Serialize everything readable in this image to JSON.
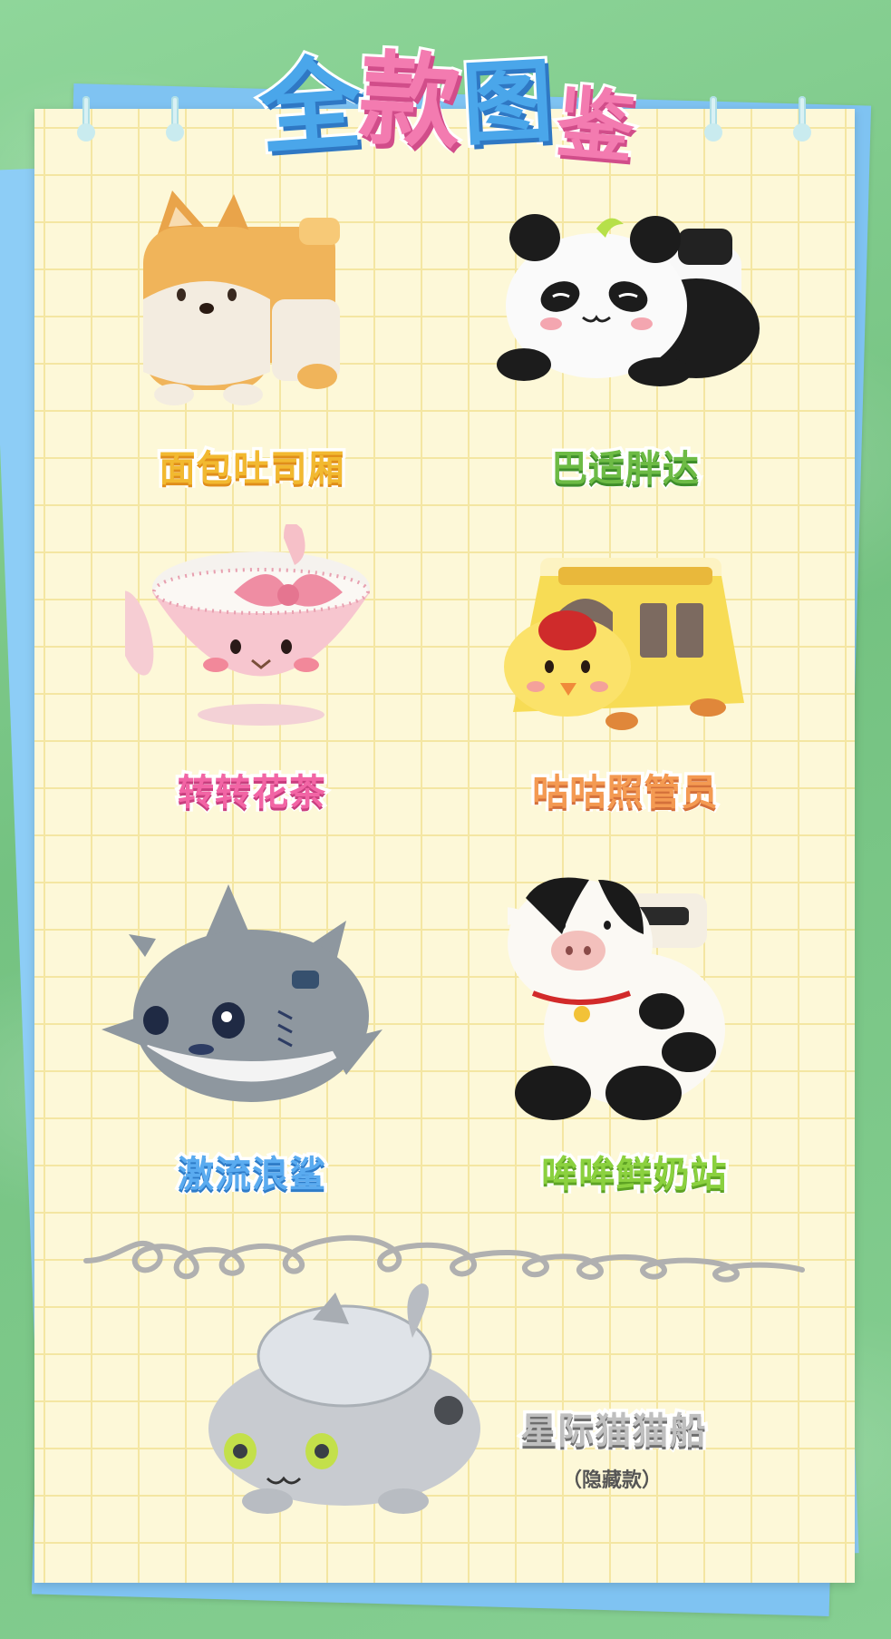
{
  "title": {
    "chars": [
      "全",
      "款",
      "图",
      "鉴"
    ]
  },
  "items": [
    {
      "name": "面包吐司厢",
      "color": "#f2b930",
      "shadow": "#e08e1a",
      "icon": "corgi-plush-icon"
    },
    {
      "name": "巴适胖达",
      "color": "#6dbb45",
      "shadow": "#3f8e2a",
      "icon": "panda-plush-icon"
    },
    {
      "name": "转转花茶",
      "color": "#f265a5",
      "shadow": "#c93f7f",
      "icon": "bunny-teacup-plush-icon"
    },
    {
      "name": "咕咕照管员",
      "color": "#f49a52",
      "shadow": "#d4703a",
      "icon": "chick-schoolbus-plush-icon"
    },
    {
      "name": "激流浪鲨",
      "color": "#5aabf0",
      "shadow": "#2f7cc8",
      "icon": "shark-plush-icon"
    },
    {
      "name": "哞哞鲜奶站",
      "color": "#8bd13f",
      "shadow": "#5ea324",
      "icon": "cow-plush-icon"
    }
  ],
  "hidden": {
    "name": "星际猫猫船",
    "note": "（隐藏款）",
    "color": "#bfbfbf",
    "shadow": "#6e6e6e",
    "icon": "cat-ufo-plush-icon"
  }
}
